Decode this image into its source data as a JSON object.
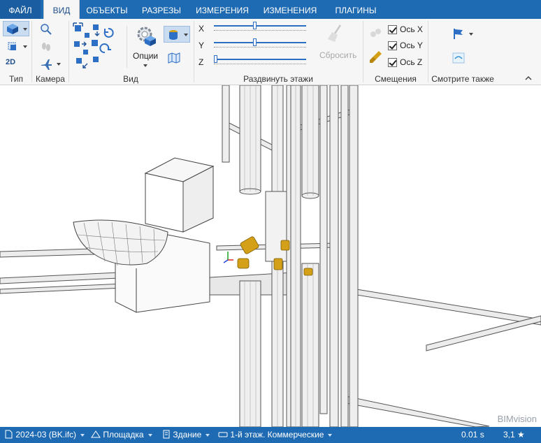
{
  "tabs": {
    "file": "ФАЙЛ",
    "view": "ВИД",
    "objects": "ОБЪЕКТЫ",
    "sections": "РАЗРЕЗЫ",
    "measures": "ИЗМЕРЕНИЯ",
    "changes": "ИЗМЕНЕНИЯ",
    "plugins": "ПЛАГИНЫ"
  },
  "ribbon": {
    "groups": {
      "type": "Тип",
      "camera": "Камера",
      "view": "Вид",
      "spread": "Раздвинуть этажи",
      "offsets": "Смещения",
      "see_also": "Смотрите также"
    },
    "view_type_2d": "2D",
    "options_label": "Опции",
    "reset_label": "Сбросить",
    "sliders": [
      {
        "axis": "X",
        "value": 0.44
      },
      {
        "axis": "Y",
        "value": 0.44
      },
      {
        "axis": "Z",
        "value": 0.0
      }
    ],
    "offsets": [
      {
        "label": "Ось X",
        "checked": true
      },
      {
        "label": "Ось Y",
        "checked": true
      },
      {
        "label": "Ось Z",
        "checked": true
      }
    ]
  },
  "viewport": {
    "watermark": "BIMvision"
  },
  "statusbar": {
    "file": "2024-03 (BK.ifc)",
    "site": "Площадка",
    "building": "Здание",
    "storey": "1-й этаж. Коммерческие",
    "time": "0.01 s",
    "rating": "3,1 ★"
  },
  "colors": {
    "accent": "#1f6bb3",
    "fitting": "#d4a017"
  }
}
